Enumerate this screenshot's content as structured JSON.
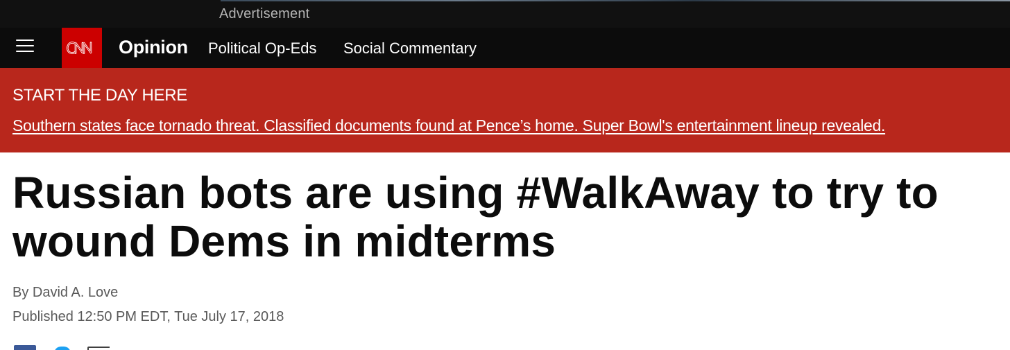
{
  "ad": {
    "label": "Advertisement"
  },
  "nav": {
    "menu_icon": "hamburger-menu-icon",
    "logo_text": "CNN",
    "section": "Opinion",
    "links": [
      "Political Op-Eds",
      "Social Commentary"
    ]
  },
  "banner": {
    "kicker": "START THE DAY HERE",
    "link": "Southern states face tornado threat. Classified documents found at Pence’s home. Super Bowl's entertainment lineup revealed."
  },
  "article": {
    "headline": "Russian bots are using #WalkAway to try to wound Dems in midterms",
    "byline": "By David A. Love",
    "published": "Published 12:50 PM EDT, Tue July 17, 2018"
  },
  "share": {
    "icons": [
      "facebook-icon",
      "twitter-icon",
      "email-icon"
    ]
  },
  "colors": {
    "nav_background": "#0c0c0c",
    "brand_red": "#cc0000",
    "banner_red": "#b8271c",
    "headline": "#0c0c0c",
    "meta_text": "#595959"
  }
}
